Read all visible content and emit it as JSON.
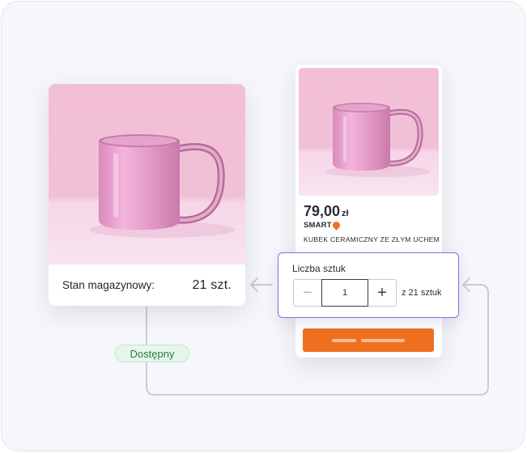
{
  "stock_card": {
    "label": "Stan magazynowy:",
    "value": "21 szt."
  },
  "product_card": {
    "price_amount": "79,00",
    "price_currency": "zł",
    "brand_badge": "SMART",
    "name": "KUBEK CERAMICZNY ZE ZŁYM UCHEM"
  },
  "quantity": {
    "label": "Liczba sztuk",
    "minus_symbol": "−",
    "value": "1",
    "plus_symbol": "+",
    "of_text": "z 21 sztuk"
  },
  "availability": {
    "label": "Dostępny"
  },
  "colors": {
    "accent_orange": "#f07022",
    "highlight_purple": "#8a6fe0",
    "available_green": "#2d7a43",
    "mug_pink": "#eba6d2"
  },
  "icons": [
    "mug-photo",
    "smart-pin-icon",
    "minus-icon",
    "plus-icon",
    "arrow-left-icon"
  ]
}
